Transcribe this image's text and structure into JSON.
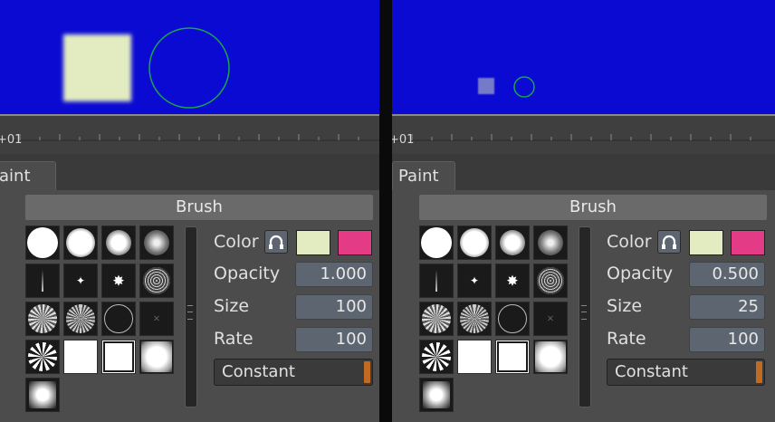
{
  "panels": [
    {
      "timeline_label": "+01",
      "tab_label": "aint",
      "brush_header": "Brush",
      "color_label": "Color",
      "color1": "#e2ecc0",
      "color2": "#e43b86",
      "opacity_label": "Opacity",
      "opacity_value": "1.000",
      "size_label": "Size",
      "size_value": "100",
      "rate_label": "Rate",
      "rate_value": "100",
      "mode_value": "Constant"
    },
    {
      "timeline_label": "+01",
      "tab_label": "Paint",
      "brush_header": "Brush",
      "color_label": "Color",
      "color1": "#e2ecc0",
      "color2": "#e43b86",
      "opacity_label": "Opacity",
      "opacity_value": "0.500",
      "size_label": "Size",
      "size_value": "25",
      "rate_label": "Rate",
      "rate_value": "100",
      "mode_value": "Constant"
    }
  ],
  "colors": {
    "viewer_bg": "#0a0ad2",
    "stroke_circle": "#1aa54a",
    "accent": "#c06a22"
  },
  "icons": [
    "pick-color-icon",
    "brush-presets"
  ]
}
